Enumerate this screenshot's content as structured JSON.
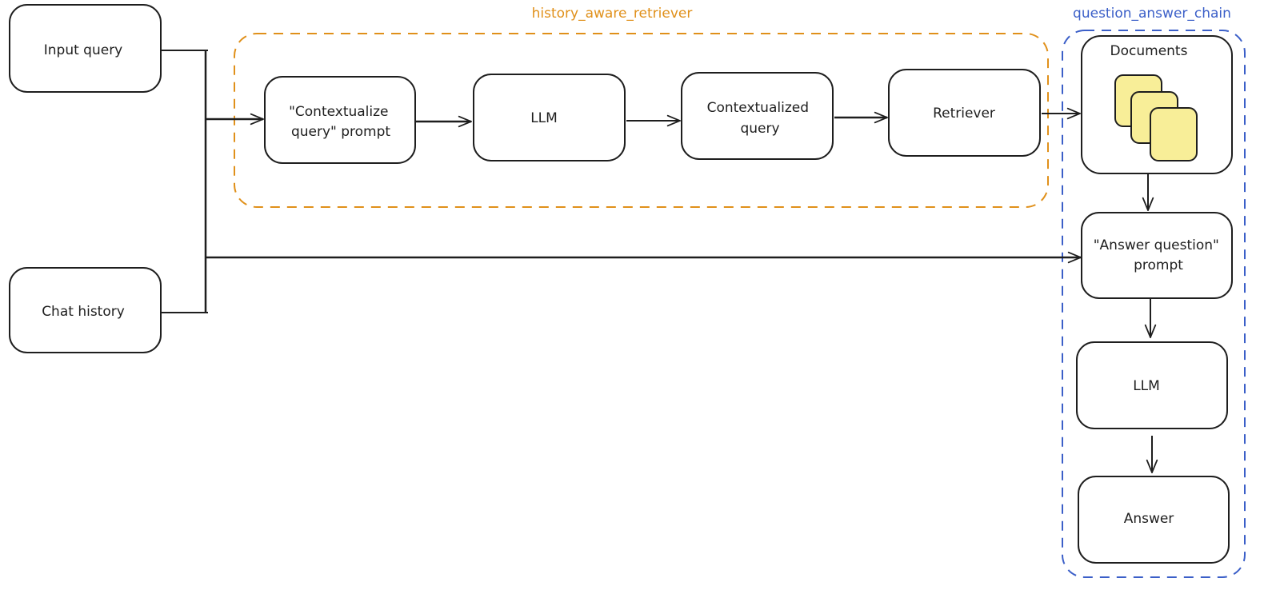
{
  "diagram": {
    "groups": {
      "history_aware_retriever": {
        "label": "history_aware_retriever",
        "color": "#e0901a"
      },
      "question_answer_chain": {
        "label": "question_answer_chain",
        "color": "#3b5fc8"
      }
    },
    "nodes": {
      "input_query": {
        "lines": [
          "Input query"
        ]
      },
      "chat_history": {
        "lines": [
          "Chat history"
        ]
      },
      "contextualize_prompt": {
        "lines": [
          "\"Contextualize",
          "query\" prompt"
        ]
      },
      "llm_1": {
        "lines": [
          "LLM"
        ]
      },
      "contextualized_query": {
        "lines": [
          "Contextualized",
          "query"
        ]
      },
      "retriever": {
        "lines": [
          "Retriever"
        ]
      },
      "documents": {
        "lines": [
          "Documents"
        ]
      },
      "answer_prompt": {
        "lines": [
          "\"Answer question\"",
          "prompt"
        ]
      },
      "llm_2": {
        "lines": [
          "LLM"
        ]
      },
      "answer": {
        "lines": [
          "Answer"
        ]
      }
    },
    "edges": [
      {
        "from": "input_query",
        "to": "contextualize_prompt"
      },
      {
        "from": "chat_history",
        "to": "contextualize_prompt"
      },
      {
        "from": "input_query",
        "to": "answer_prompt"
      },
      {
        "from": "chat_history",
        "to": "answer_prompt"
      },
      {
        "from": "contextualize_prompt",
        "to": "llm_1"
      },
      {
        "from": "llm_1",
        "to": "contextualized_query"
      },
      {
        "from": "contextualized_query",
        "to": "retriever"
      },
      {
        "from": "retriever",
        "to": "documents"
      },
      {
        "from": "documents",
        "to": "answer_prompt"
      },
      {
        "from": "answer_prompt",
        "to": "llm_2"
      },
      {
        "from": "llm_2",
        "to": "answer"
      }
    ],
    "colors": {
      "stroke": "#1e1e1e",
      "node_fill": "#ffffff",
      "document_fill": "#f8ee98"
    }
  }
}
